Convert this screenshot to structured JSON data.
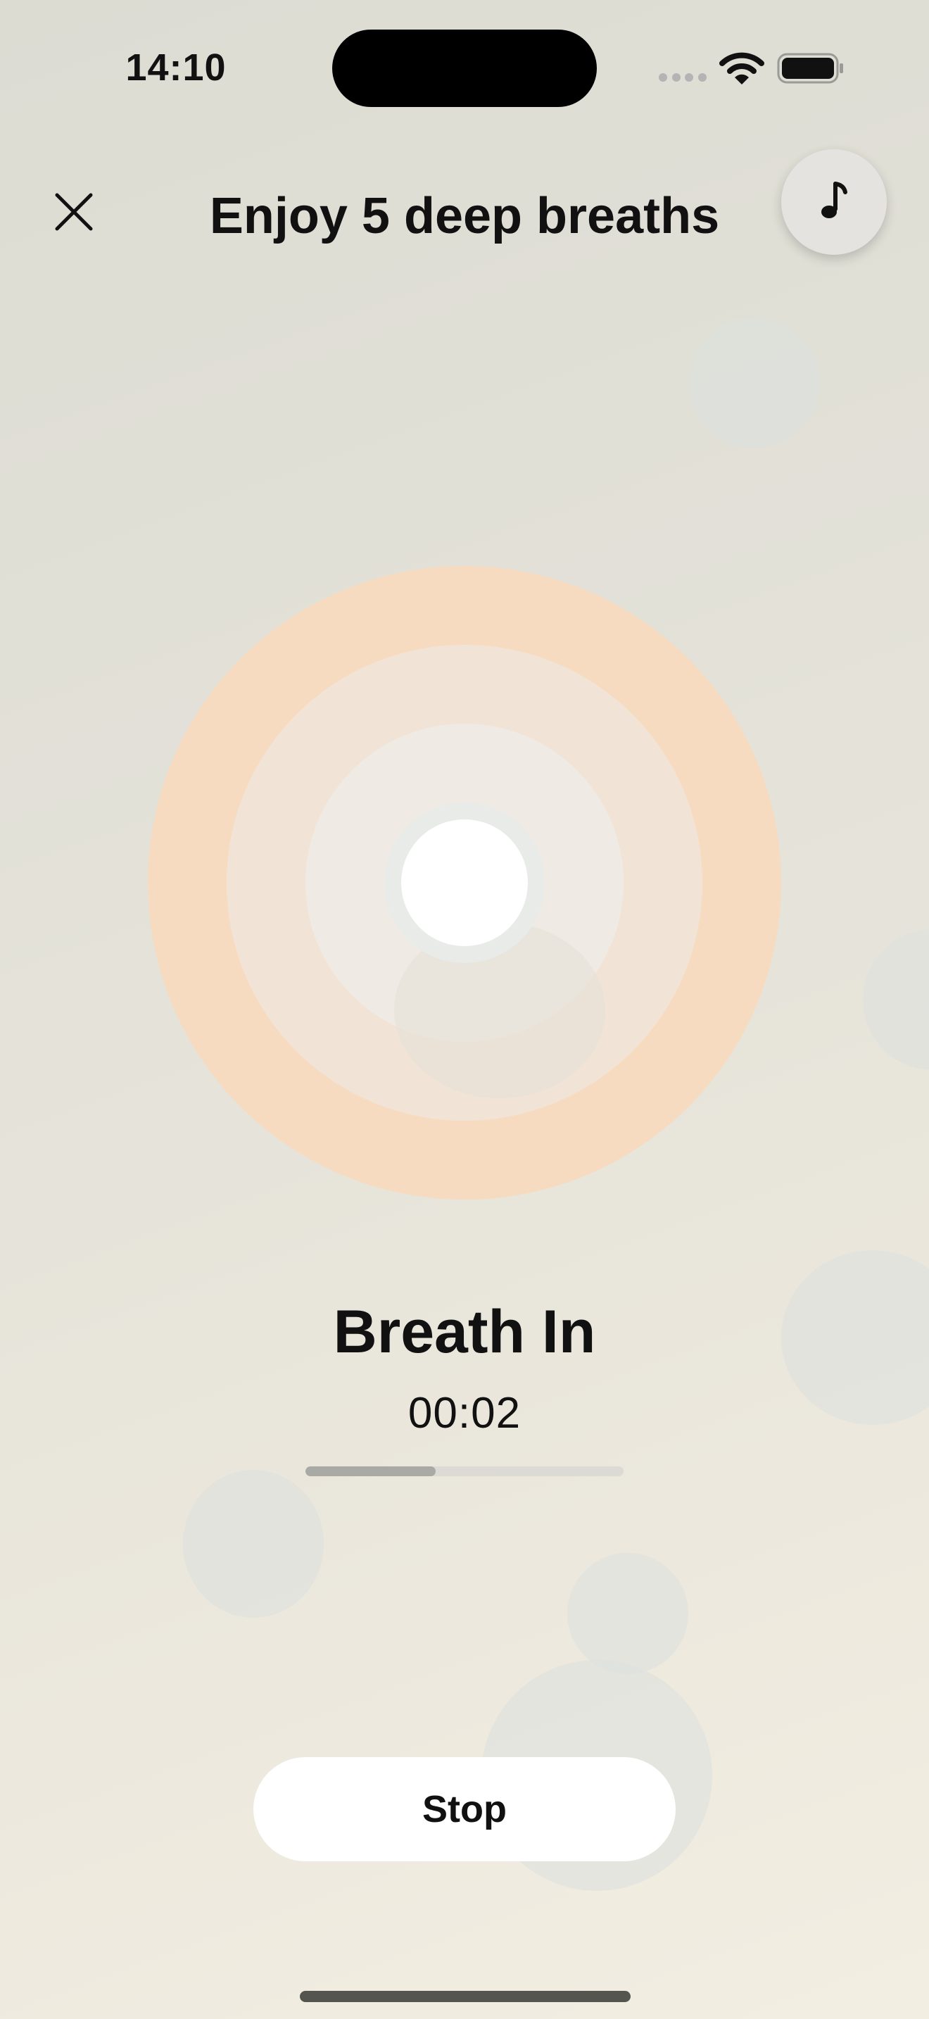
{
  "status_bar": {
    "time": "14:10",
    "icons": [
      "cellular-signal-icon",
      "wifi-icon",
      "battery-icon"
    ]
  },
  "header": {
    "title": "Enjoy 5 deep breaths",
    "close_icon": "close-icon",
    "music_icon": "music-note-icon"
  },
  "session": {
    "phase": "Breath In",
    "timer": "00:02",
    "progress": 0.41
  },
  "actions": {
    "stop_label": "Stop"
  },
  "colors": {
    "outer_ring": "#f6dbc0",
    "middle_ring": "#f1e4d6",
    "inner_ring": "#efebe4",
    "core": "#ffffff",
    "progress_fill": "#a9a9a6",
    "progress_track": "#dcdad4"
  }
}
